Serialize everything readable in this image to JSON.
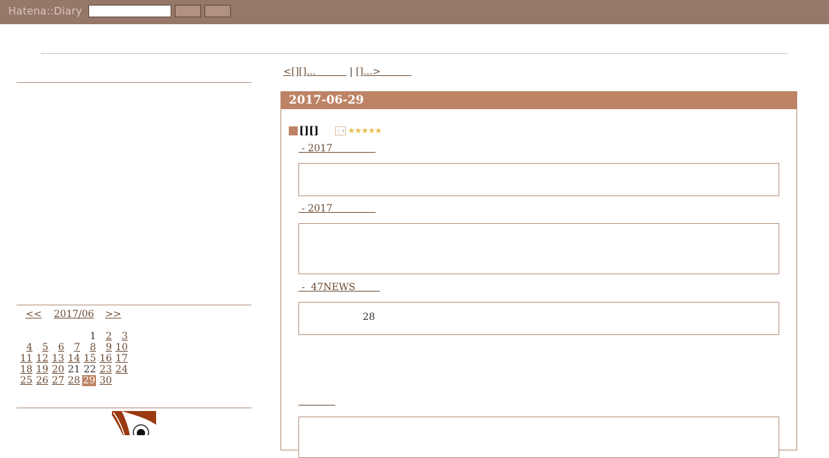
{
  "header": {
    "logo": "Hatena::Diary",
    "search_value": ""
  },
  "pager": {
    "prev": "<[][]...          ",
    "separator": " | ",
    "next": "[]...>          "
  },
  "day": {
    "date": "2017-06-29",
    "section_title": "[][]",
    "star_add": "☆+",
    "stars": "★★★★★",
    "links": [
      " - 2017              ",
      " - 2017              ",
      " -  47NEWS        ",
      "            "
    ],
    "embeds": [
      {
        "text": ""
      },
      {
        "text": ""
      },
      {
        "text": "28"
      },
      {
        "text": ""
      }
    ]
  },
  "calendar": {
    "prev": "<<",
    "month": "2017/06",
    "next": ">>",
    "weeks": [
      [
        "",
        "",
        "",
        "",
        "1",
        "2",
        "3"
      ],
      [
        "4",
        "5",
        "6",
        "7",
        "8",
        "9",
        "10"
      ],
      [
        "11",
        "12",
        "13",
        "14",
        "15",
        "16",
        "17"
      ],
      [
        "18",
        "19",
        "20",
        "21",
        "22",
        "23",
        "24"
      ],
      [
        "25",
        "26",
        "27",
        "28",
        "29",
        "30",
        ""
      ]
    ],
    "plain_days": [
      "1",
      "21",
      "22"
    ],
    "today": "29"
  },
  "colors": {
    "topbar": "#967868",
    "accent": "#bd8364",
    "link": "#6b4a33"
  }
}
